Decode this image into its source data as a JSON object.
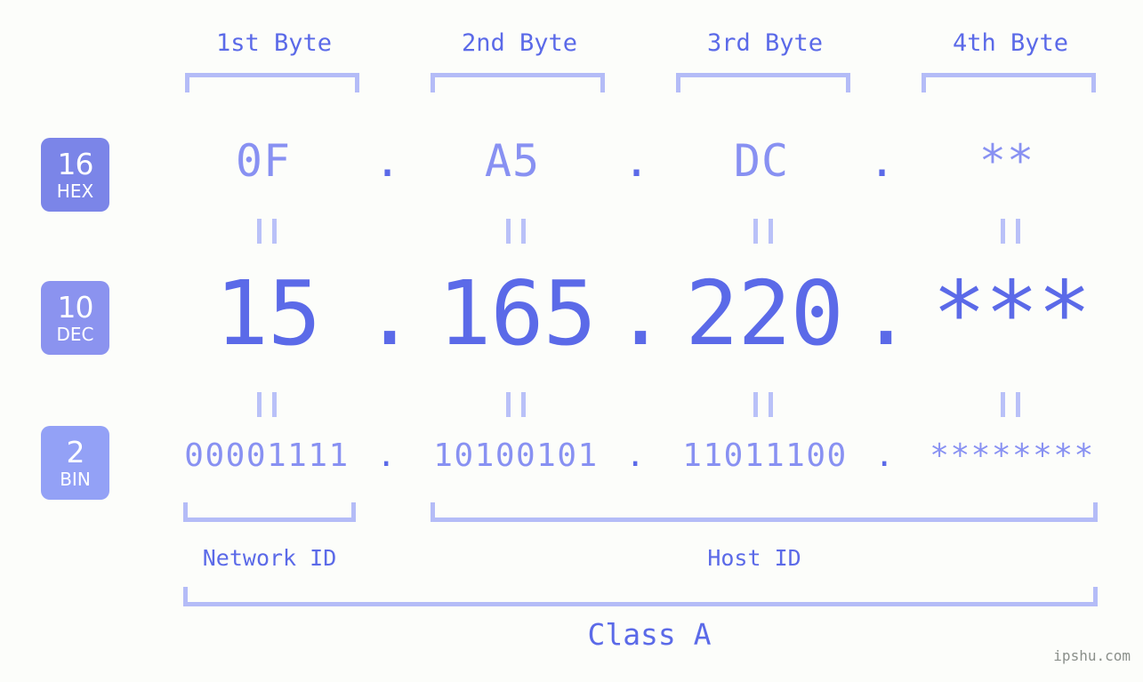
{
  "background_color": "#fcfdfa",
  "accent_color": "#5b6ae8",
  "accent_light_color": "#8891f2",
  "bracket_color": "#b4bcf7",
  "byte_headers": [
    {
      "label": "1st Byte"
    },
    {
      "label": "2nd Byte"
    },
    {
      "label": "3rd Byte"
    },
    {
      "label": "4th Byte"
    }
  ],
  "bases": [
    {
      "number": "16",
      "abbr": "HEX",
      "color": "#7b85e8"
    },
    {
      "number": "10",
      "abbr": "DEC",
      "color": "#8b93ef"
    },
    {
      "number": "2",
      "abbr": "BIN",
      "color": "#93a1f6"
    }
  ],
  "separator": ".",
  "equals_symbol": "=",
  "rows": {
    "hex": {
      "base": "16",
      "values": [
        "0F",
        "A5",
        "DC",
        "**"
      ]
    },
    "dec": {
      "base": "10",
      "values": [
        "15",
        "165",
        "220",
        "***"
      ]
    },
    "bin": {
      "base": "2",
      "values": [
        "00001111",
        "10100101",
        "11011100",
        "********"
      ]
    }
  },
  "regions": [
    {
      "name": "network-id",
      "label": "Network ID"
    },
    {
      "name": "host-id",
      "label": "Host ID"
    }
  ],
  "class": {
    "label": "Class A"
  },
  "watermark": {
    "text": "ipshu.com"
  }
}
